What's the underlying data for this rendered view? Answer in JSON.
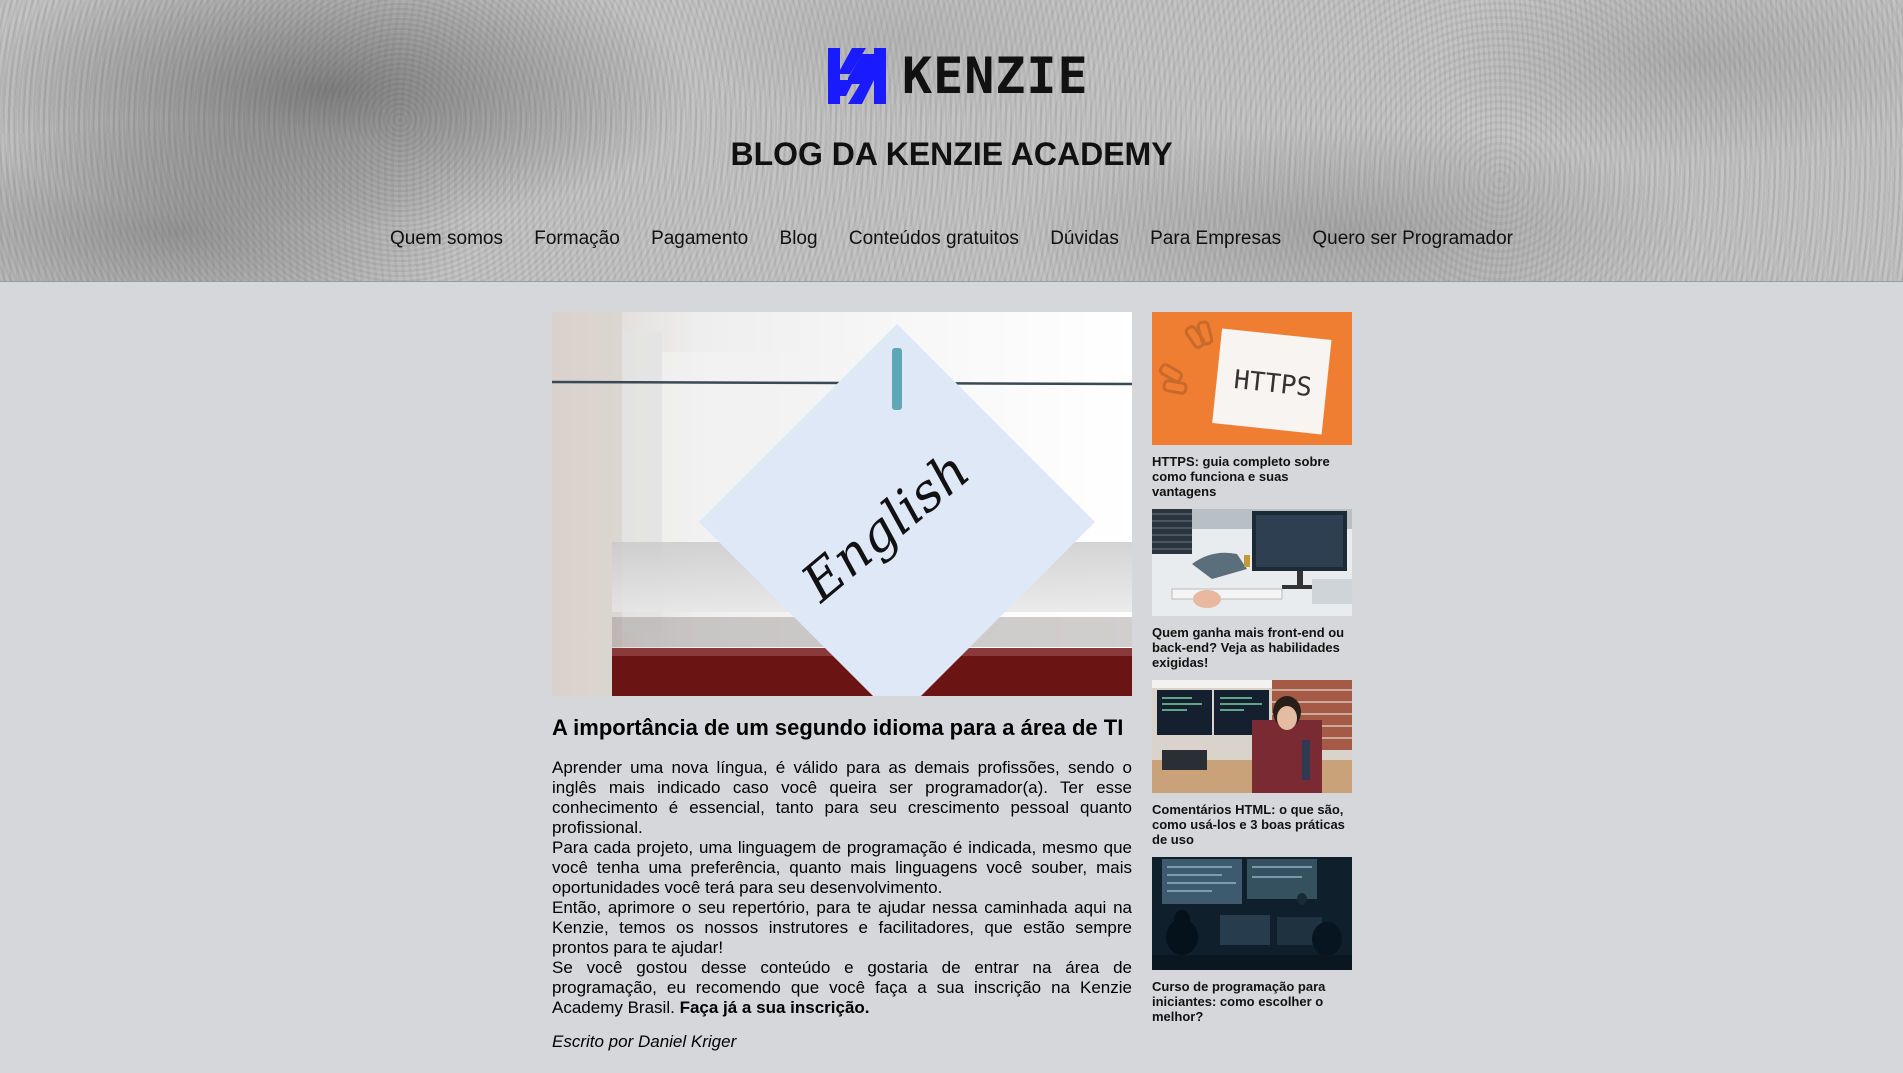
{
  "header": {
    "logo_text": "KENZIE",
    "blog_title": "BLOG DA KENZIE ACADEMY",
    "nav": [
      "Quem somos",
      "Formação",
      "Pagamento",
      "Blog",
      "Conteúdos gratuitos",
      "Dúvidas",
      "Para Empresas",
      "Quero ser Programador"
    ]
  },
  "article": {
    "image_note_text": "English",
    "title": "A importância de um segundo idioma para a área de TI",
    "paragraphs": [
      "Aprender uma nova língua, é válido para as demais profissões, sendo o inglês mais indicado caso você queira ser programador(a). Ter esse conhecimento é essencial, tanto para seu crescimento pessoal quanto profissional.",
      "Para cada projeto, uma linguagem de programação é indicada, mesmo que você tenha uma preferência, quanto mais linguagens você souber, mais oportunidades você terá para seu desenvolvimento.",
      "Então, aprimore o seu repertório, para te ajudar nessa caminhada aqui na Kenzie, temos os nossos instrutores e facilitadores, que estão sempre prontos para te ajudar!",
      "Se você gostou desse conteúdo e gostaria de entrar na área de programação, eu recomendo que você faça a sua inscrição na Kenzie Academy Brasil."
    ],
    "cta": "Faça já a sua inscrição.",
    "author": "Escrito por Daniel Kriger"
  },
  "sidebar": {
    "posts": [
      {
        "title": "HTTPS: guia completo sobre como funciona e suas vantagens",
        "image_text": "HTTPS"
      },
      {
        "title": "Quem ganha mais front-end ou back-end? Veja as habilidades exigidas!"
      },
      {
        "title": "Comentários HTML: o que são, como usá-los e 3 boas práticas de uso"
      },
      {
        "title": "Curso de programação para iniciantes: como escolher o melhor?"
      }
    ]
  },
  "colors": {
    "page_background": "#d6d7da",
    "logo_blue": "#1a1aff",
    "https_card_orange": "#f07e32"
  }
}
